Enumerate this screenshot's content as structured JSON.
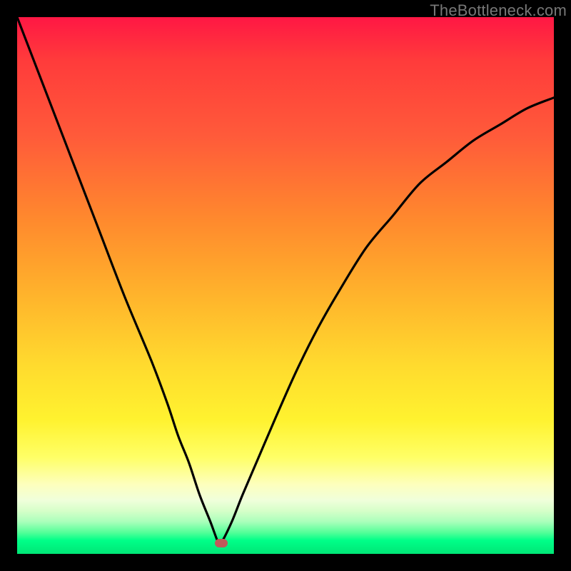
{
  "watermark": "TheBottleneck.com",
  "chart_data": {
    "type": "line",
    "title": "",
    "xlabel": "",
    "ylabel": "",
    "xlim": [
      0,
      100
    ],
    "ylim": [
      0,
      100
    ],
    "series": [
      {
        "name": "bottleneck-curve",
        "x": [
          0,
          5,
          10,
          15,
          20,
          25,
          28,
          30,
          32,
          34,
          36,
          37.5,
          38,
          40,
          42,
          45,
          48,
          52,
          56,
          60,
          65,
          70,
          75,
          80,
          85,
          90,
          95,
          100
        ],
        "values": [
          100,
          87,
          74,
          61,
          48,
          36,
          28,
          22,
          17,
          11,
          6,
          2,
          2,
          6,
          11,
          18,
          25,
          34,
          42,
          49,
          57,
          63,
          69,
          73,
          77,
          80,
          83,
          85
        ]
      }
    ],
    "marker": {
      "x": 38,
      "y": 2,
      "color": "#c05a5a"
    },
    "gradient_stops": [
      {
        "pos": 0,
        "color": "#ff1744"
      },
      {
        "pos": 0.5,
        "color": "#ffd600"
      },
      {
        "pos": 0.9,
        "color": "#ffffaa"
      },
      {
        "pos": 1.0,
        "color": "#00e676"
      }
    ]
  }
}
